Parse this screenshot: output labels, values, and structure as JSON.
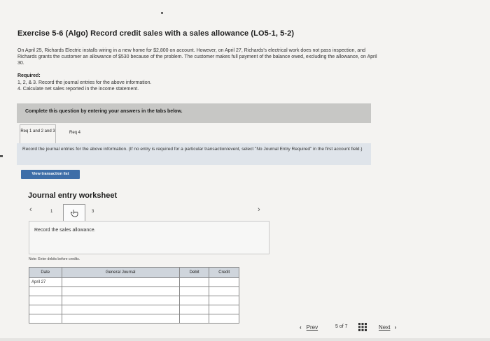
{
  "exercise": {
    "title": "Exercise 5-6 (Algo) Record credit sales with a sales allowance (LO5-1, 5-2)",
    "description": "On April 25, Richards Electric installs wiring in a new home for $2,800 on account. However, on April 27, Richards's electrical work does not pass inspection, and Richards grants the customer an allowance of $530 because of the problem. The customer makes full payment of the balance owed, excluding the allowance, on April 30.",
    "required_label": "Required:",
    "required_items": [
      "1, 2, & 3. Record the journal entries for the above information.",
      "4. Calculate net sales reported in the income statement."
    ]
  },
  "banner": {
    "text": "Complete this question by entering your answers in the tabs below."
  },
  "tabs": [
    {
      "label": "Req 1 and 2 and 3",
      "active": true
    },
    {
      "label": "Req 4",
      "active": false
    }
  ],
  "instruction": "Record the journal entries for the above information. (If no entry is required for a particular transaction/event, select \"No Journal Entry Required\" in the first account field.)",
  "view_transaction_button": "View transaction list",
  "worksheet": {
    "title": "Journal entry worksheet",
    "pages": [
      "1",
      "2",
      "3"
    ],
    "current_page": "2",
    "entry_description": "Record the sales allowance.",
    "note": "Note: Enter debits before credits.",
    "columns": [
      "Date",
      "General Journal",
      "Debit",
      "Credit"
    ],
    "rows": [
      {
        "date": "April 27",
        "account": "",
        "debit": "",
        "credit": ""
      },
      {
        "date": "",
        "account": "",
        "debit": "",
        "credit": ""
      },
      {
        "date": "",
        "account": "",
        "debit": "",
        "credit": ""
      },
      {
        "date": "",
        "account": "",
        "debit": "",
        "credit": ""
      },
      {
        "date": "",
        "account": "",
        "debit": "",
        "credit": ""
      }
    ]
  },
  "footer": {
    "prev_label": "Prev",
    "page_current": "5",
    "page_of": "of",
    "page_total": "7",
    "next_label": "Next"
  },
  "colors": {
    "button_blue": "#3e6ea8",
    "banner_gray": "#c7c7c5",
    "panel_blue_gray": "#dfe4ea"
  },
  "icons": {
    "prev": "chevron-left-icon",
    "next": "chevron-right-icon",
    "grid": "grid-icon",
    "hand": "hand-pointer-icon"
  }
}
